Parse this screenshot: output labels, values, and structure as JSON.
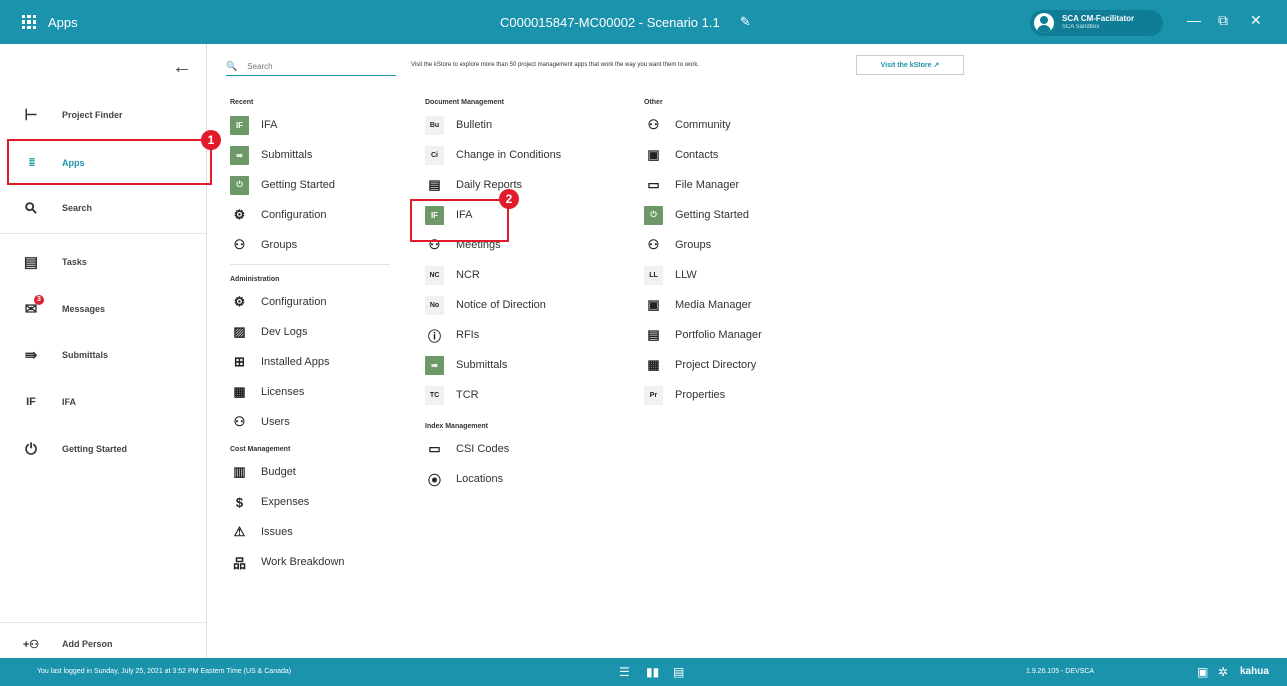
{
  "topbar": {
    "apps_label": "Apps",
    "title": "C000015847-MC00002 - Scenario 1.1",
    "user_name": "SCA CM-Facilitator",
    "user_org": "SCA Sandbox",
    "minimize": "—",
    "restore": "⧉",
    "close": "✕"
  },
  "sidebar": {
    "back": "←",
    "items": [
      {
        "icon": "project-finder-icon",
        "glyph": "⊢",
        "label": "Project Finder"
      },
      {
        "icon": "apps-grid-icon",
        "glyph": "⁞⁞⁞",
        "label": "Apps"
      },
      {
        "icon": "search-icon",
        "glyph": "⚲",
        "label": "Search"
      },
      {
        "icon": "clipboard-icon",
        "glyph": "▤",
        "label": "Tasks"
      },
      {
        "icon": "mail-icon",
        "glyph": "✉",
        "label": "Messages",
        "badge": "3"
      },
      {
        "icon": "submittals-icon",
        "glyph": "⇛",
        "label": "Submittals"
      },
      {
        "icon": "ifa-icon",
        "glyph": "IF",
        "label": "IFA"
      },
      {
        "icon": "power-icon",
        "glyph": "⏻",
        "label": "Getting Started"
      }
    ],
    "add_person": "Add Person",
    "add_person_glyph": "+⚇"
  },
  "annotations": {
    "one": "1",
    "two": "2"
  },
  "search": {
    "placeholder": "Search",
    "glyph": "🔍"
  },
  "kstore": {
    "text": "Visit the kStore to explore more than 50 project management apps that work the way you want them to work.",
    "button": "Visit the kStore ↗"
  },
  "columns": {
    "recent": {
      "title": "Recent",
      "items": [
        {
          "tile": "green",
          "t": "IF",
          "label": "IFA"
        },
        {
          "tile": "green",
          "t": "⇛",
          "label": "Submittals"
        },
        {
          "tile": "green",
          "t": "⏻",
          "label": "Getting Started"
        },
        {
          "tile": "ico",
          "t": "⚙",
          "label": "Configuration"
        },
        {
          "tile": "ico",
          "t": "⚇",
          "label": "Groups"
        }
      ]
    },
    "administration": {
      "title": "Administration",
      "items": [
        {
          "tile": "ico",
          "t": "⚙",
          "label": "Configuration"
        },
        {
          "tile": "ico",
          "t": "▨",
          "label": "Dev Logs"
        },
        {
          "tile": "ico",
          "t": "⊞",
          "label": "Installed Apps"
        },
        {
          "tile": "ico",
          "t": "▦",
          "label": "Licenses"
        },
        {
          "tile": "ico",
          "t": "⚇",
          "label": "Users"
        }
      ]
    },
    "cost": {
      "title": "Cost Management",
      "items": [
        {
          "tile": "ico",
          "t": "▥",
          "label": "Budget"
        },
        {
          "tile": "ico",
          "t": "$",
          "label": "Expenses"
        },
        {
          "tile": "ico",
          "t": "⚠",
          "label": "Issues"
        },
        {
          "tile": "ico",
          "t": "品",
          "label": "Work Breakdown"
        }
      ]
    },
    "document": {
      "title": "Document Management",
      "items": [
        {
          "tile": "txt",
          "t": "Bu",
          "label": "Bulletin"
        },
        {
          "tile": "txt",
          "t": "Ci",
          "label": "Change in Conditions"
        },
        {
          "tile": "ico",
          "t": "▤",
          "label": "Daily Reports"
        },
        {
          "tile": "green",
          "t": "IF",
          "label": "IFA"
        },
        {
          "tile": "ico",
          "t": "⚇",
          "label": "Meetings"
        },
        {
          "tile": "txt",
          "t": "NC",
          "label": "NCR"
        },
        {
          "tile": "txt",
          "t": "No",
          "label": "Notice of Direction"
        },
        {
          "tile": "ico",
          "t": "ⓘ",
          "label": "RFIs"
        },
        {
          "tile": "green",
          "t": "⇛",
          "label": "Submittals"
        },
        {
          "tile": "txt",
          "t": "TC",
          "label": "TCR"
        }
      ]
    },
    "index": {
      "title": "Index Management",
      "items": [
        {
          "tile": "ico",
          "t": "▭",
          "label": "CSI Codes"
        },
        {
          "tile": "ico",
          "t": "⦿",
          "label": "Locations"
        }
      ]
    },
    "other": {
      "title": "Other",
      "items": [
        {
          "tile": "ico",
          "t": "⚇",
          "label": "Community"
        },
        {
          "tile": "ico",
          "t": "▣",
          "label": "Contacts"
        },
        {
          "tile": "ico",
          "t": "▭",
          "label": "File Manager"
        },
        {
          "tile": "green",
          "t": "⏻",
          "label": "Getting Started"
        },
        {
          "tile": "ico",
          "t": "⚇",
          "label": "Groups"
        },
        {
          "tile": "txt",
          "t": "LL",
          "label": "LLW"
        },
        {
          "tile": "ico",
          "t": "▣",
          "label": "Media Manager"
        },
        {
          "tile": "ico",
          "t": "▤",
          "label": "Portfolio Manager"
        },
        {
          "tile": "ico",
          "t": "▦",
          "label": "Project Directory"
        },
        {
          "tile": "txt",
          "t": "Pr",
          "label": "Properties"
        }
      ]
    }
  },
  "status": {
    "last_login": "You last logged in Sunday, July 25, 2021 at 3:52 PM Eastern Time (US & Canada)",
    "version": "1.9.26.105 - DEVSCA",
    "brand": "kahua"
  },
  "colors": {
    "accent": "#1b93ad",
    "annotation": "#e21b2a",
    "tile_green": "#6d9968"
  }
}
